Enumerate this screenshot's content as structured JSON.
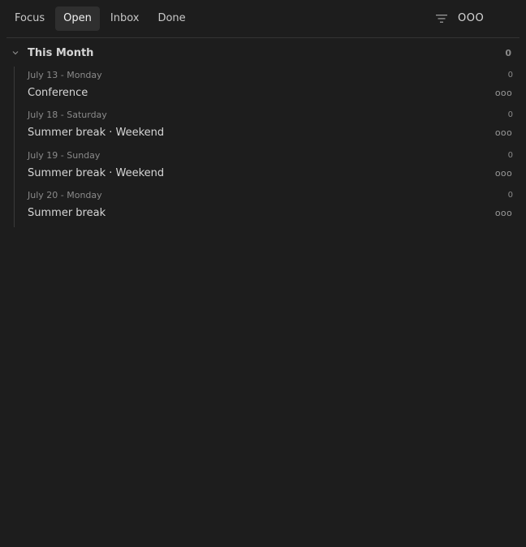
{
  "tabs": [
    {
      "label": "Focus",
      "active": false
    },
    {
      "label": "Open",
      "active": true
    },
    {
      "label": "Inbox",
      "active": false
    },
    {
      "label": "Done",
      "active": false
    }
  ],
  "toolbar": {
    "filter_icon": "filter-icon",
    "ooo_label": "OOO"
  },
  "section": {
    "title": "This Month",
    "count": "0",
    "chevron_icon": "chevron-down-icon"
  },
  "entries": [
    {
      "date": "July 13 - Monday",
      "count": "0",
      "title": "Conference",
      "more": "ooo"
    },
    {
      "date": "July 18 - Saturday",
      "count": "0",
      "title": "Summer break · Weekend",
      "more": "ooo"
    },
    {
      "date": "July 19 - Sunday",
      "count": "0",
      "title": "Summer break · Weekend",
      "more": "ooo"
    },
    {
      "date": "July 20 - Monday",
      "count": "0",
      "title": "Summer break",
      "more": "ooo"
    }
  ],
  "colors": {
    "background": "#1d1d1d",
    "active_tab": "#2f2f2f",
    "muted_text": "#8a8a8a"
  }
}
